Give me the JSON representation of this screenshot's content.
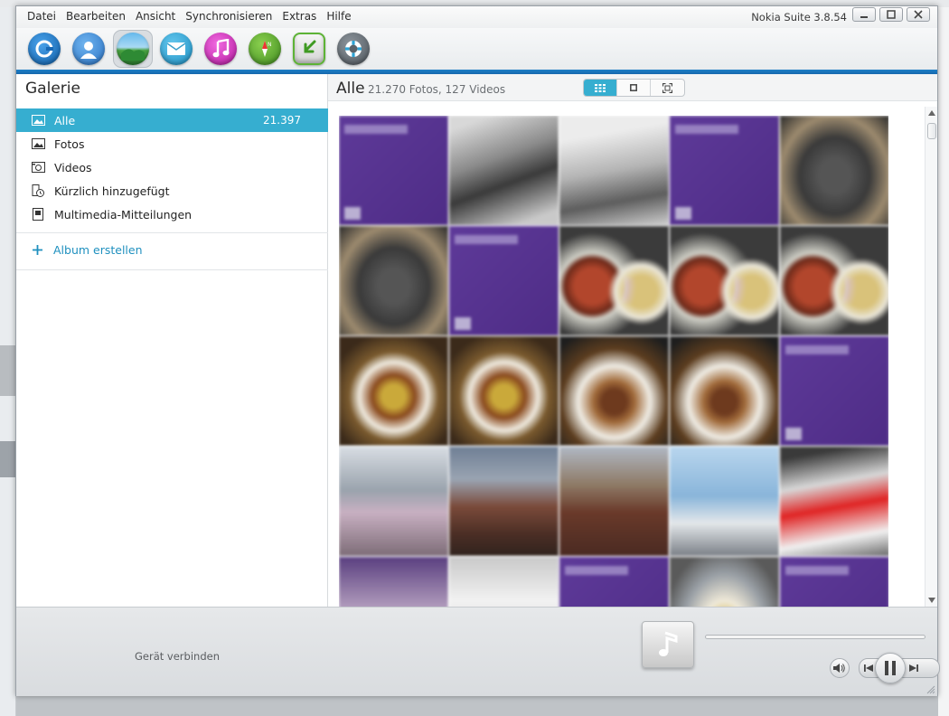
{
  "window": {
    "app_title": "Nokia Suite 3.8.54",
    "menu": [
      "Datei",
      "Bearbeiten",
      "Ansicht",
      "Synchronisieren",
      "Extras",
      "Hilfe"
    ]
  },
  "toolbar": {
    "tools": [
      {
        "name": "home-tool",
        "icon": "nokia-suite-icon",
        "color": "#1a78c8",
        "active": false
      },
      {
        "name": "contacts-tool",
        "icon": "contacts-person-icon",
        "color": "#3a8de0",
        "active": false
      },
      {
        "name": "gallery-tool",
        "icon": "gallery-landscape-icon",
        "color": "#2e8f3c",
        "active": true
      },
      {
        "name": "messages-tool",
        "icon": "messages-envelope-icon",
        "color": "#2aa3d3",
        "active": false
      },
      {
        "name": "music-tool",
        "icon": "music-note-icon",
        "color": "#d62fc1",
        "active": false
      },
      {
        "name": "maps-tool",
        "icon": "maps-compass-icon",
        "color": "#5aa52d",
        "active": false
      },
      {
        "name": "store-tool",
        "icon": "download-arrow-icon",
        "color": "#5db336",
        "active": false
      },
      {
        "name": "support-tool",
        "icon": "support-lifebuoy-icon",
        "color": "#6b7278",
        "active": false
      }
    ]
  },
  "sidebar": {
    "title": "Galerie",
    "items": [
      {
        "label": "Alle",
        "count": "21.397",
        "icon": "all-images-icon",
        "selected": true
      },
      {
        "label": "Fotos",
        "count": "",
        "icon": "photos-icon",
        "selected": false
      },
      {
        "label": "Videos",
        "count": "",
        "icon": "videos-icon",
        "selected": false
      },
      {
        "label": "Kürzlich hinzugefügt",
        "count": "",
        "icon": "recent-clock-icon",
        "selected": false
      },
      {
        "label": "Multimedia-Mitteilungen",
        "count": "",
        "icon": "mms-icon",
        "selected": false
      }
    ],
    "create_album": "Album erstellen"
  },
  "main": {
    "title": "Alle",
    "subtitle": "21.270 Fotos, 127 Videos",
    "view_modes": [
      {
        "name": "grid-view",
        "icon": "grid-view-icon",
        "active": true
      },
      {
        "name": "single-view",
        "icon": "single-view-icon",
        "active": false
      },
      {
        "name": "fullscreen-view",
        "icon": "fullscreen-icon",
        "active": false
      }
    ],
    "thumbnails": [
      "purple",
      "t-box",
      "t-printer",
      "purple",
      "t-bag",
      "t-bag",
      "purple",
      "t-stew",
      "t-stew",
      "t-stew",
      "t-plate",
      "t-plate",
      "t-plate2",
      "t-plate2",
      "purple",
      "t-mag",
      "t-people",
      "t-people2",
      "t-screen",
      "t-red",
      "t-mag2",
      "t-paper",
      "purple",
      "t-dish",
      "purple"
    ]
  },
  "player": {
    "connect_label": "Gerät verbinden",
    "progress": 0,
    "controls": [
      "volume-icon",
      "previous-icon",
      "pause-icon",
      "next-icon"
    ]
  },
  "colors": {
    "accent": "#36aed0",
    "link": "#1f90bf",
    "title_bar_blue": "#1d7fc7"
  }
}
